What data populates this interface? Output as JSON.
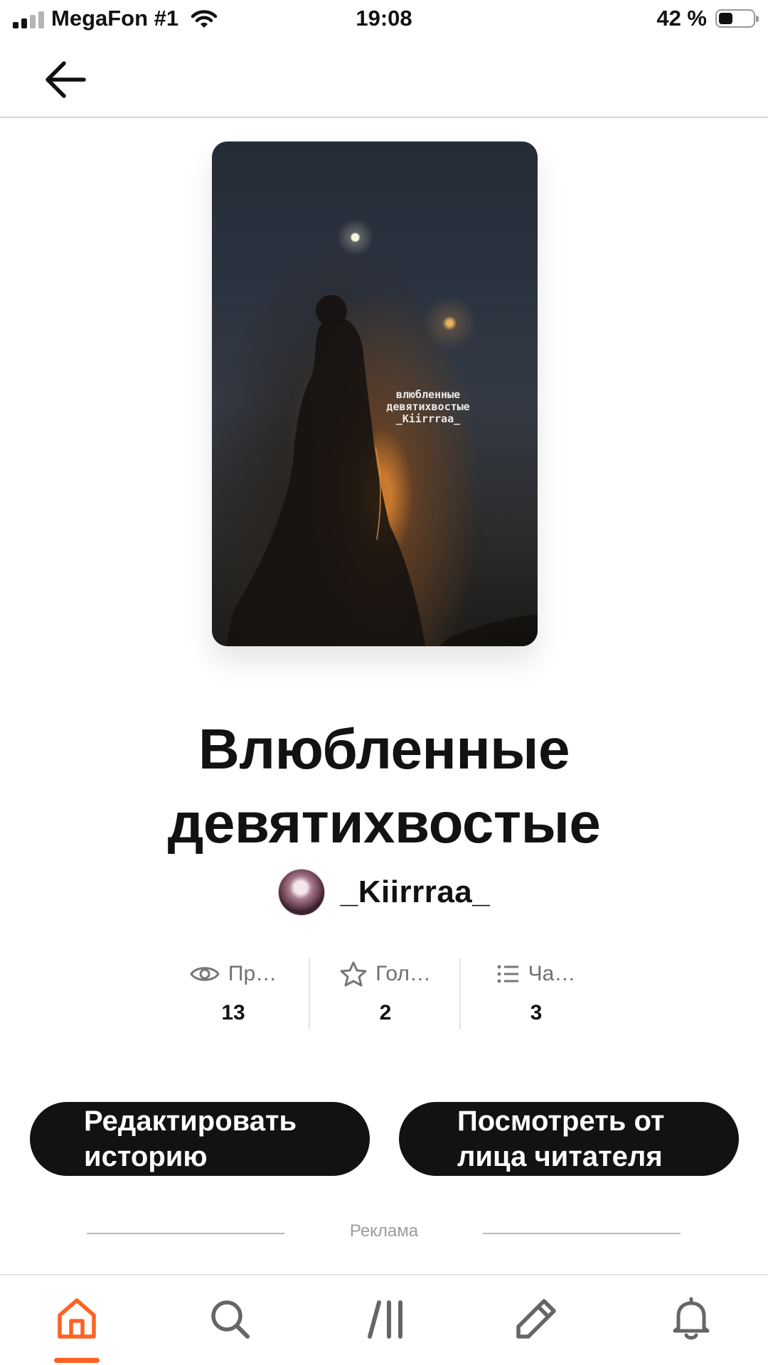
{
  "status_bar": {
    "carrier": "MegaFon #1",
    "time": "19:08",
    "battery": "42 %",
    "battery_level": 0.42
  },
  "top_bar": {
    "back_icon": "arrow-left-icon"
  },
  "story": {
    "cover_text": [
      "влюбленные",
      "девятихвостые",
      "_Kiirrraa_"
    ],
    "title_lines": [
      "Влюбленные",
      "девятихвостые"
    ],
    "author": "_Kiirrraa_"
  },
  "stats": [
    {
      "icon": "eye-icon",
      "label": "Пр…",
      "value": "13"
    },
    {
      "icon": "star-icon",
      "label": "Гол…",
      "value": "2"
    },
    {
      "icon": "list-icon",
      "label": "Ча…",
      "value": "3"
    }
  ],
  "actions": {
    "edit_lines": [
      "Редактировать",
      "историю"
    ],
    "preview_lines": [
      "Посмотреть от",
      "лица читателя"
    ]
  },
  "ad_label": "Реклама",
  "bottom_nav": {
    "items": [
      "home-icon",
      "search-icon",
      "library-icon",
      "pencil-icon",
      "bell-icon"
    ],
    "active": "home-icon"
  },
  "colors": {
    "accent": "#ff6122",
    "button": "#121212",
    "text": "#121212"
  }
}
